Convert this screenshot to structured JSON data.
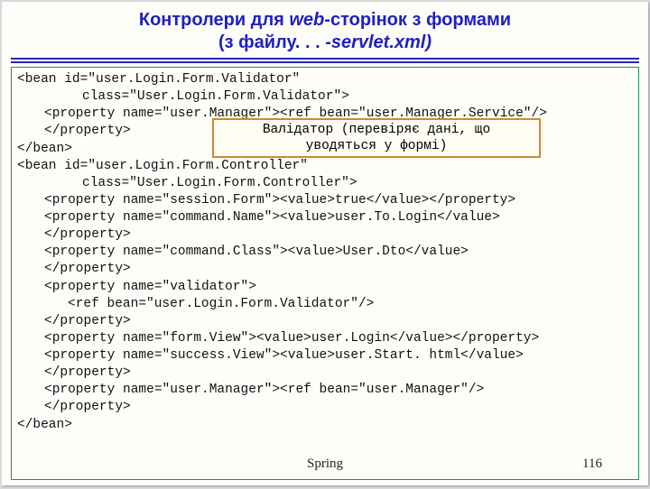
{
  "title_line1_a": "Контролери для ",
  "title_line1_b": "web",
  "title_line1_c": "-сторінок з формами",
  "title_line2_a": "(з файлу. . . ",
  "title_line2_b": "-servlet.xml)",
  "code": {
    "l1": "<bean id=\"user.Login.Form.Validator\"",
    "l2": "class=\"User.Login.Form.Validator\">",
    "l3": "<property name=\"user.Manager\"><ref bean=\"user.Manager.Service\"/>",
    "l4": "</property>",
    "l5": "</bean>",
    "l6": "<bean id=\"user.Login.Form.Controller\"",
    "l7": "class=\"User.Login.Form.Controller\">",
    "l8": "<property name=\"session.Form\"><value>true</value></property>",
    "l9": "<property name=\"command.Name\"><value>user.To.Login</value>",
    "l10": "</property>",
    "l11": "<property name=\"command.Class\"><value>User.Dto</value>",
    "l12": "</property>",
    "l13": "<property name=\"validator\">",
    "l14": "<ref bean=\"user.Login.Form.Validator\"/>",
    "l15": "</property>",
    "l16": "<property name=\"form.View\"><value>user.Login</value></property>",
    "l17": "<property name=\"success.View\"><value>user.Start. html</value>",
    "l18": "</property>",
    "l19": "<property name=\"user.Manager\"><ref bean=\"user.Manager\"/>",
    "l20": "</property>",
    "l21": "</bean>"
  },
  "callout": {
    "line1": "Валідатор (перевіряє дані, що",
    "line2": "уводяться у формі)"
  },
  "footer": "Spring",
  "page": "116"
}
